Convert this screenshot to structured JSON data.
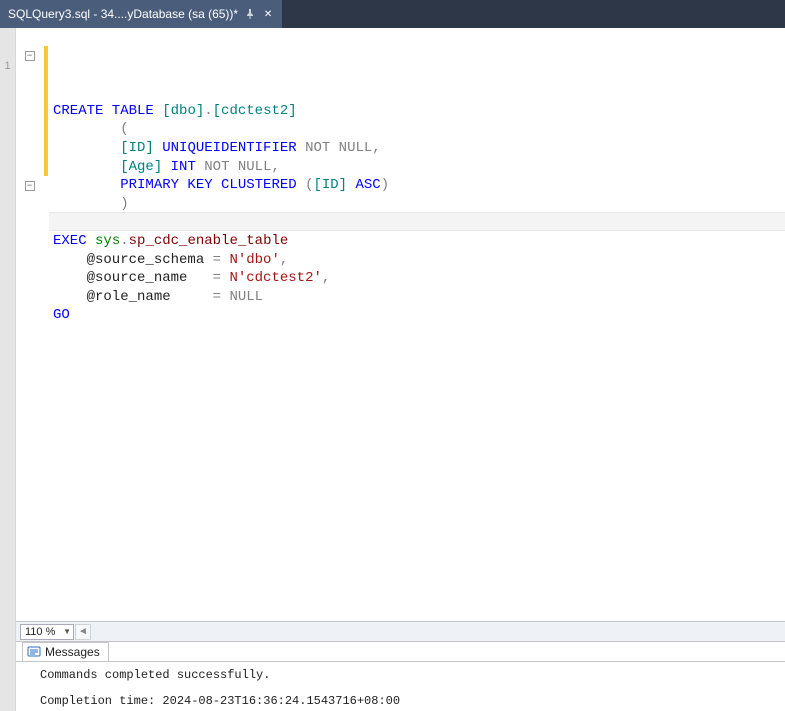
{
  "tab": {
    "title": "SQLQuery3.sql - 34....yDatabase (sa (65))*"
  },
  "left_gutter": {
    "label": "1"
  },
  "zoom": {
    "value": "110 %"
  },
  "messages": {
    "tab_label": "Messages",
    "result": "Commands completed successfully.",
    "completion": "Completion time: 2024-08-23T16:36:24.1543716+08:00"
  },
  "sql": {
    "lines": [
      [
        {
          "t": "CREATE TABLE",
          "c": "k-blue"
        },
        {
          "t": " "
        },
        {
          "t": "[dbo]",
          "c": "k-teal"
        },
        {
          "t": ".",
          "c": "k-gray"
        },
        {
          "t": "[cdctest2]",
          "c": "k-teal"
        }
      ],
      [
        {
          "t": "        ",
          "c": ""
        },
        {
          "t": "(",
          "c": "k-gray"
        }
      ],
      [
        {
          "t": "        "
        },
        {
          "t": "[ID]",
          "c": "k-teal"
        },
        {
          "t": " "
        },
        {
          "t": "UNIQUEIDENTIFIER",
          "c": "k-blue"
        },
        {
          "t": " "
        },
        {
          "t": "NOT NULL",
          "c": "k-gray"
        },
        {
          "t": ",",
          "c": "k-gray"
        }
      ],
      [
        {
          "t": "        "
        },
        {
          "t": "[Age]",
          "c": "k-teal"
        },
        {
          "t": " "
        },
        {
          "t": "INT",
          "c": "k-blue"
        },
        {
          "t": " "
        },
        {
          "t": "NOT NULL",
          "c": "k-gray"
        },
        {
          "t": ",",
          "c": "k-gray"
        }
      ],
      [
        {
          "t": "        "
        },
        {
          "t": "PRIMARY KEY CLUSTERED",
          "c": "k-blue"
        },
        {
          "t": " ",
          "c": ""
        },
        {
          "t": "(",
          "c": "k-gray"
        },
        {
          "t": "[ID]",
          "c": "k-teal"
        },
        {
          "t": " "
        },
        {
          "t": "ASC",
          "c": "k-blue"
        },
        {
          "t": ")",
          "c": "k-gray"
        }
      ],
      [
        {
          "t": "        "
        },
        {
          "t": ")",
          "c": "k-gray"
        }
      ],
      [
        {
          "t": " "
        }
      ],
      [
        {
          "t": "EXEC",
          "c": "k-blue"
        },
        {
          "t": " "
        },
        {
          "t": "sys",
          "c": "k-green"
        },
        {
          "t": ".",
          "c": "k-gray"
        },
        {
          "t": "sp_cdc_enable_table",
          "c": "k-darkred"
        }
      ],
      [
        {
          "t": "    @source_schema "
        },
        {
          "t": "=",
          "c": "k-gray"
        },
        {
          "t": " "
        },
        {
          "t": "N'dbo'",
          "c": "k-maroon"
        },
        {
          "t": ",",
          "c": "k-gray"
        }
      ],
      [
        {
          "t": "    @source_name   "
        },
        {
          "t": "=",
          "c": "k-gray"
        },
        {
          "t": " "
        },
        {
          "t": "N'cdctest2'",
          "c": "k-maroon"
        },
        {
          "t": ",",
          "c": "k-gray"
        }
      ],
      [
        {
          "t": "    @role_name     "
        },
        {
          "t": "=",
          "c": "k-gray"
        },
        {
          "t": " "
        },
        {
          "t": "NULL",
          "c": "k-gray"
        }
      ],
      [
        {
          "t": "GO",
          "c": "k-blue"
        }
      ]
    ],
    "fold_buttons": [
      0,
      7
    ],
    "change_bar_lines": 7,
    "highlighted_line": 9
  }
}
